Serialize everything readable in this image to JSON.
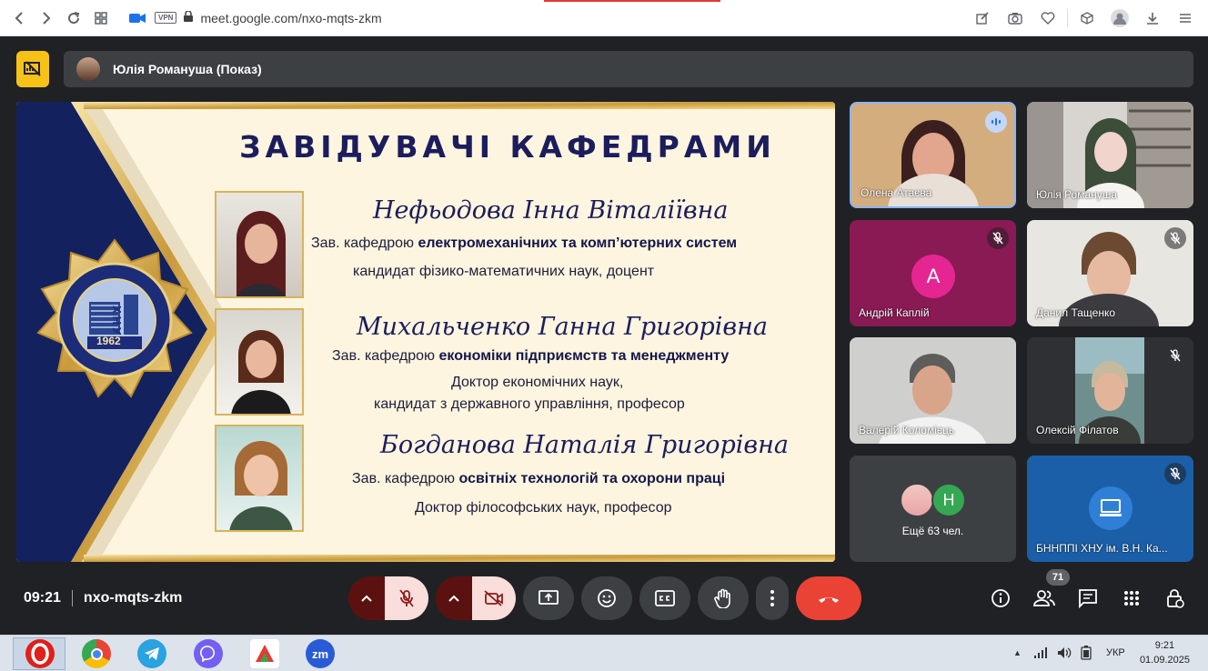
{
  "browser": {
    "url": "meet.google.com/nxo-mqts-zkm",
    "vpn_label": "VPN"
  },
  "presentation": {
    "presenter": "Юлія Романуша (Показ)"
  },
  "slide": {
    "title": "ЗАВІДУВАЧІ КАФЕДРАМИ",
    "emblem": {
      "text": "ХНУ",
      "year": "1962",
      "ring_text": "БАХМУТСЬКИЙ НАВЧАЛЬНО-НАУКОВИЙ ПРОФЕСІЙНО-ПЕДАГОГІЧНИЙ ІНСТИТУТ"
    },
    "people": [
      {
        "name": "Нефьодова Інна Віталіївна",
        "prefix": "Зав. кафедрою",
        "dept": "електромеханічних та комп’ютерних систем",
        "degree_lines": [
          "кандидат фізико-математичних наук, доцент"
        ]
      },
      {
        "name": "Михальченко Ганна Григорівна",
        "prefix": "Зав. кафедрою",
        "dept": "економіки підприємств та менеджменту",
        "degree_lines": [
          "Доктор економічних наук,",
          "кандидат з державного управління, професор"
        ]
      },
      {
        "name": "Богданова Наталія Григорівна",
        "prefix": "Зав. кафедрою",
        "dept": "освітніх технологій та охорони праці",
        "degree_lines": [
          "Доктор філософських наук, професор"
        ]
      }
    ]
  },
  "participants": [
    {
      "name": "Олена Атаєва",
      "state": "speaking"
    },
    {
      "name": "Юлія Романуша",
      "state": "video"
    },
    {
      "name": "Андрій Каплій",
      "initial": "A",
      "state": "muted",
      "avatar_color": "#e52592"
    },
    {
      "name": "Данил Тащенко",
      "state": "muted"
    },
    {
      "name": "Валерій Коломієць",
      "state": "video"
    },
    {
      "name": "Олексій Філатов",
      "state": "muted"
    },
    {
      "name": "БННППІ ХНУ ім. В.Н. Ка...",
      "state": "muted"
    }
  ],
  "more": {
    "label": "Ещё 63 чел.",
    "initial": "Н"
  },
  "meeting": {
    "time": "09:21",
    "code": "nxo-mqts-zkm",
    "people_count": "71"
  },
  "taskbar": {
    "zoom_label": "zm",
    "lang": "УКР",
    "time": "9:21",
    "date": "01.09.2025"
  },
  "colors": {
    "meet_bg": "#202124",
    "end_call": "#ea4335",
    "present_accent": "#f7c218",
    "slide_title": "#1b1d5c"
  }
}
